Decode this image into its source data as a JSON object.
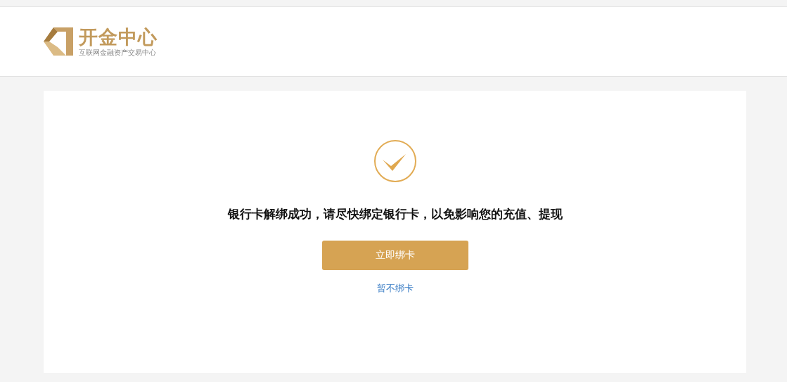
{
  "logo": {
    "name": "开金中心",
    "tagline": "互联网金融资产交易中心"
  },
  "result": {
    "message": "银行卡解绑成功，请尽快绑定银行卡，以免影响您的充值、提现",
    "primary_button": "立即绑卡",
    "secondary_link": "暂不绑卡"
  }
}
